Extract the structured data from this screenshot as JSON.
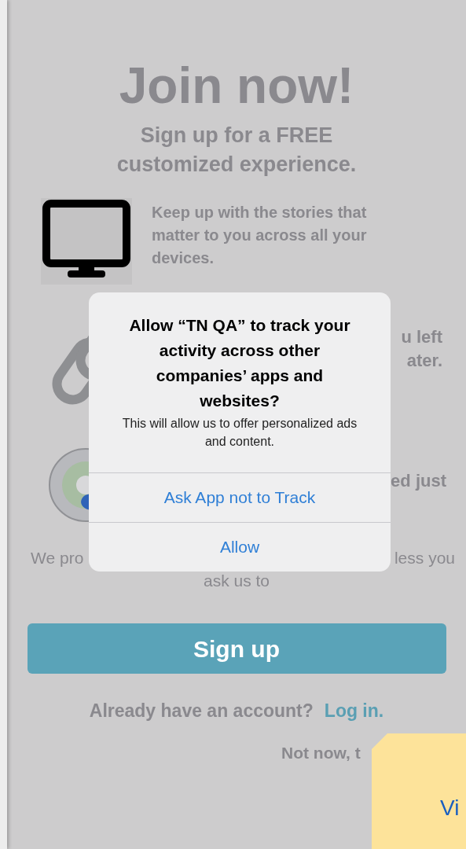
{
  "header": {
    "title": "Join now!",
    "subtitle_lines": [
      "Sign up for a FREE",
      "customized experience."
    ]
  },
  "features": [
    {
      "kind": "monitor",
      "lines": [
        "Keep up with the stories that",
        "matter to you across all your",
        "devices."
      ]
    },
    {
      "kind": "link",
      "lines": [
        "u left",
        "ater."
      ]
    },
    {
      "kind": "disc",
      "lines": [
        "ed just"
      ]
    }
  ],
  "promise": {
    "line_1_start": "We pro",
    "line_1_end": "less you",
    "line_2": "ask us to"
  },
  "sign_up_button": "Sign up",
  "login_prompt": {
    "text": "Already have an account?",
    "link": "Log in."
  },
  "not_now": "Not now, t",
  "dialog": {
    "title": "Allow “TN QA” to track your activity across other companies’ apps and websites?",
    "message": "This will allow us to offer personalized ads and content.",
    "buttons": [
      "Ask App not to Track",
      "Allow"
    ]
  },
  "note": {
    "text": "Vi"
  }
}
